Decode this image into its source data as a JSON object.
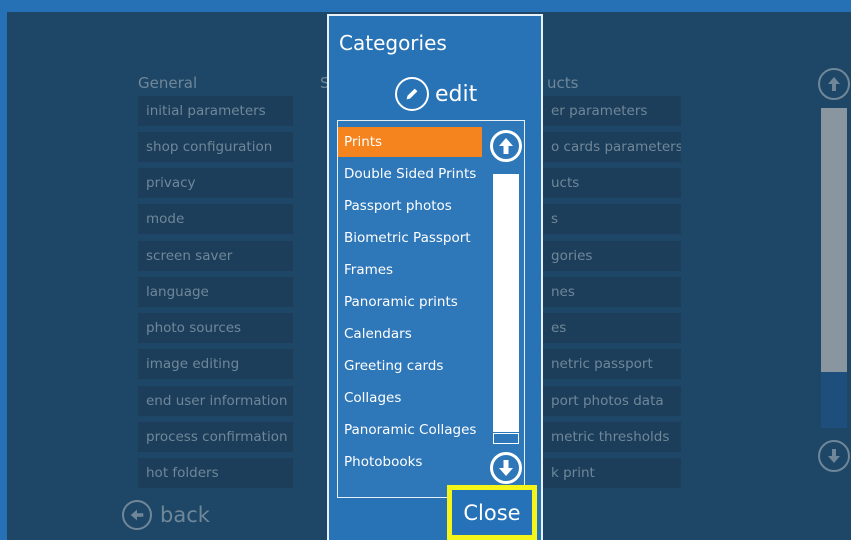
{
  "general": {
    "title": "General",
    "items": [
      "initial parameters",
      "shop configuration",
      "privacy",
      "mode",
      "screen saver",
      "language",
      "photo sources",
      "image editing",
      "end user information",
      "process confirmation",
      "hot folders"
    ]
  },
  "middle_column": {
    "title_fragment": "S"
  },
  "products": {
    "title_fragment": "ucts",
    "items": [
      "er parameters",
      "o cards parameters",
      "ucts",
      "s",
      "gories",
      "nes",
      "es",
      "netric passport",
      "port photos data",
      "metric thresholds",
      "k print"
    ]
  },
  "dialog": {
    "title": "Categories",
    "edit_label": "edit",
    "selected_index": 0,
    "categories": [
      "Prints",
      "Double Sided Prints",
      "Passport photos",
      "Biometric Passport",
      "Frames",
      "Panoramic prints",
      "Calendars",
      "Greeting cards",
      "Collages",
      "Panoramic Collages",
      "Photobooks"
    ],
    "close_label": "Close"
  },
  "footer": {
    "back_label": "back"
  },
  "icons": {
    "scroll_up": "arrow-up-circle-icon",
    "scroll_down": "arrow-down-circle-icon",
    "edit": "pencil-circle-icon",
    "back": "arrow-left-circle-icon"
  },
  "colors": {
    "background": "#2670b6",
    "dimmed_overlay": "#1e4767",
    "selected_item": "#f5831e",
    "close_highlight": "#f5f51a"
  }
}
